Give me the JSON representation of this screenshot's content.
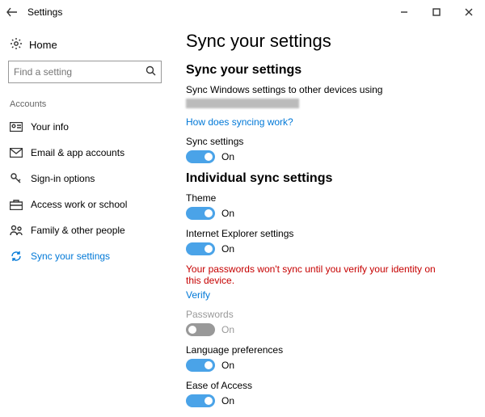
{
  "titlebar": {
    "title": "Settings"
  },
  "sidebar": {
    "home": "Home",
    "search_placeholder": "Find a setting",
    "section": "Accounts",
    "items": [
      {
        "label": "Your info"
      },
      {
        "label": "Email & app accounts"
      },
      {
        "label": "Sign-in options"
      },
      {
        "label": "Access work or school"
      },
      {
        "label": "Family & other people"
      },
      {
        "label": "Sync your settings"
      }
    ]
  },
  "content": {
    "page_title": "Sync your settings",
    "section1_title": "Sync your settings",
    "description": "Sync Windows settings to other devices using",
    "help_link": "How does syncing work?",
    "sync_settings": {
      "label": "Sync settings",
      "state": "On"
    },
    "section2_title": "Individual sync settings",
    "theme": {
      "label": "Theme",
      "state": "On"
    },
    "ie": {
      "label": "Internet Explorer settings",
      "state": "On"
    },
    "warning": "Your passwords won't sync until you verify your identity on this device.",
    "verify": "Verify",
    "passwords": {
      "label": "Passwords",
      "state": "On"
    },
    "lang": {
      "label": "Language preferences",
      "state": "On"
    },
    "ease": {
      "label": "Ease of Access",
      "state": "On"
    }
  }
}
